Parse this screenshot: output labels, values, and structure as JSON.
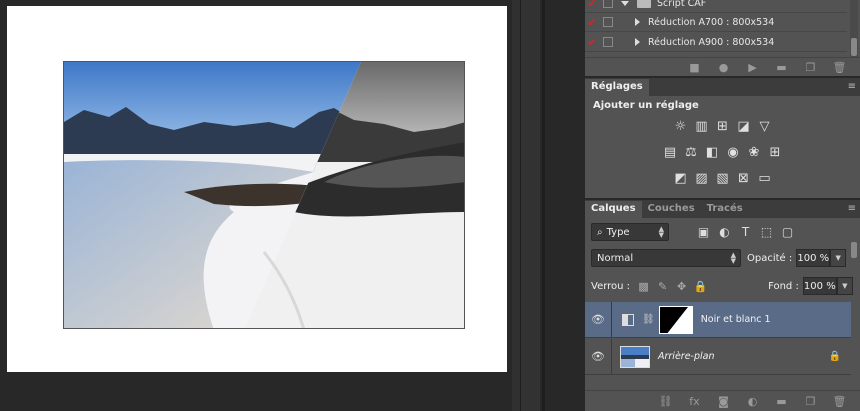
{
  "actions": {
    "rows": [
      {
        "label": "Script CAF",
        "type": "set"
      },
      {
        "label": "Réduction A700 : 800x534",
        "type": "action"
      },
      {
        "label": "Réduction A900 : 800x534",
        "type": "action"
      }
    ],
    "footer_icons": [
      "stop-icon",
      "record-icon",
      "play-icon",
      "folder-icon",
      "new-action-icon",
      "delete-icon"
    ]
  },
  "adjustments": {
    "tab": "Réglages",
    "title": "Ajouter un réglage"
  },
  "layers": {
    "tabs": [
      {
        "label": "Calques",
        "active": true
      },
      {
        "label": "Couches",
        "active": false
      },
      {
        "label": "Tracés",
        "active": false
      }
    ],
    "filter_kind": "Type",
    "blend_mode": "Normal",
    "opacity_label": "Opacité :",
    "opacity_value": "100 %",
    "lock_label": "Verrou :",
    "fill_label": "Fond :",
    "fill_value": "100 %",
    "items": [
      {
        "name": "Noir et blanc 1",
        "selected": true
      },
      {
        "name": "Arrière-plan",
        "selected": false,
        "locked": true
      }
    ]
  },
  "colors": {
    "selected_layer": "#596b86",
    "panel_bg": "#535353",
    "workspace_bg": "#282828"
  }
}
